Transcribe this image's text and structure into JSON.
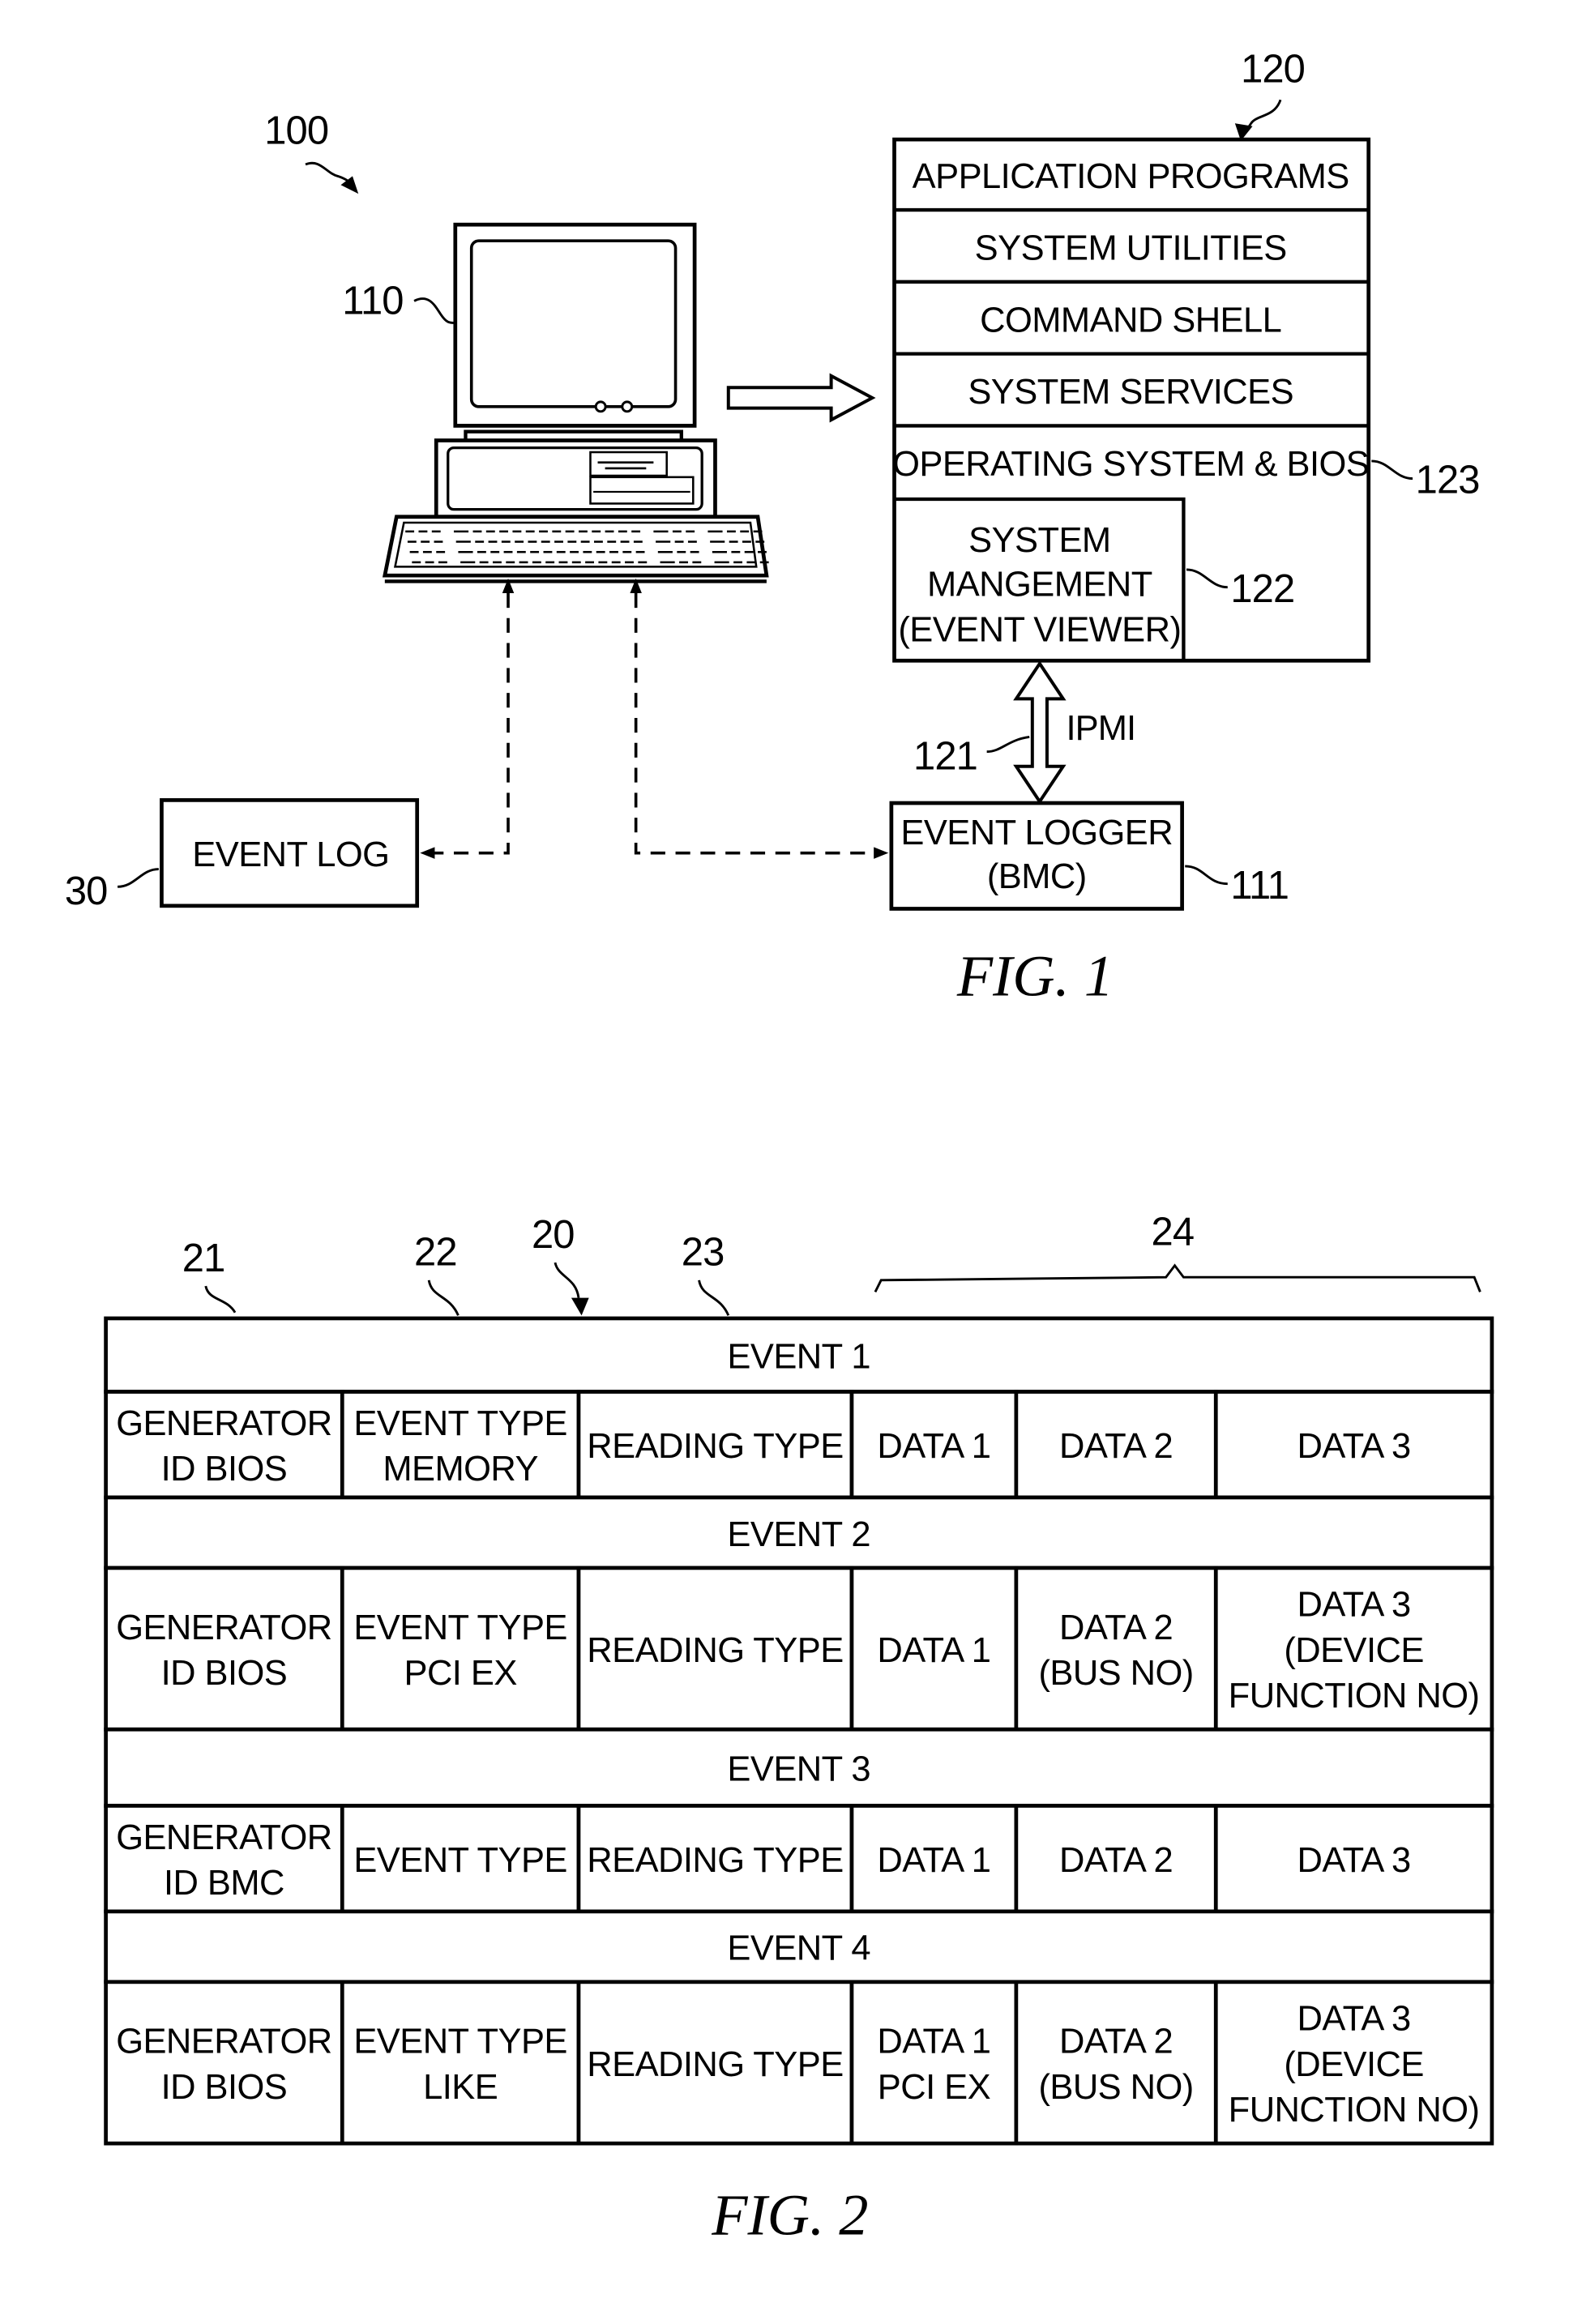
{
  "figure1": {
    "caption": "FIG. 1",
    "refs": {
      "system": "100",
      "computer": "110",
      "software_stack": "120",
      "ipmi_link": "121",
      "system_management": "122",
      "os_bios": "123",
      "event_logger": "111",
      "event_log": "30"
    },
    "stack_layers": [
      "APPLICATION PROGRAMS",
      "SYSTEM UTILITIES",
      "COMMAND SHELL",
      "SYSTEM SERVICES",
      "OPERATING SYSTEM & BIOS"
    ],
    "system_management_lines": [
      "SYSTEM",
      "MANGEMENT",
      "(EVENT VIEWER)"
    ],
    "ipmi_label": "IPMI",
    "event_logger_lines": [
      "EVENT LOGGER",
      "(BMC)"
    ],
    "event_log_label": "EVENT LOG"
  },
  "figure2": {
    "caption": "FIG. 2",
    "refs": {
      "record": "20",
      "generator_id": "21",
      "event_type": "22",
      "reading_type": "23",
      "data_fields": "24"
    },
    "events": [
      {
        "title": "EVENT 1",
        "cells": [
          [
            "GENERATOR",
            "ID BIOS"
          ],
          [
            "EVENT TYPE",
            "MEMORY"
          ],
          [
            "READING TYPE"
          ],
          [
            "DATA 1"
          ],
          [
            "DATA 2"
          ],
          [
            "DATA 3"
          ]
        ]
      },
      {
        "title": "EVENT 2",
        "cells": [
          [
            "GENERATOR",
            "ID BIOS"
          ],
          [
            "EVENT TYPE",
            "PCI EX"
          ],
          [
            "READING TYPE"
          ],
          [
            "DATA 1"
          ],
          [
            "DATA 2",
            "(BUS NO)"
          ],
          [
            "DATA 3",
            "(DEVICE",
            "FUNCTION NO)"
          ]
        ]
      },
      {
        "title": "EVENT 3",
        "cells": [
          [
            "GENERATOR",
            "ID BMC"
          ],
          [
            "EVENT TYPE"
          ],
          [
            "READING TYPE"
          ],
          [
            "DATA 1"
          ],
          [
            "DATA 2"
          ],
          [
            "DATA 3"
          ]
        ]
      },
      {
        "title": "EVENT 4",
        "cells": [
          [
            "GENERATOR",
            "ID BIOS"
          ],
          [
            "EVENT TYPE",
            "LIKE"
          ],
          [
            "READING TYPE"
          ],
          [
            "DATA 1",
            "PCI EX"
          ],
          [
            "DATA 2",
            "(BUS NO)"
          ],
          [
            "DATA 3",
            "(DEVICE",
            "FUNCTION NO)"
          ]
        ]
      }
    ]
  }
}
